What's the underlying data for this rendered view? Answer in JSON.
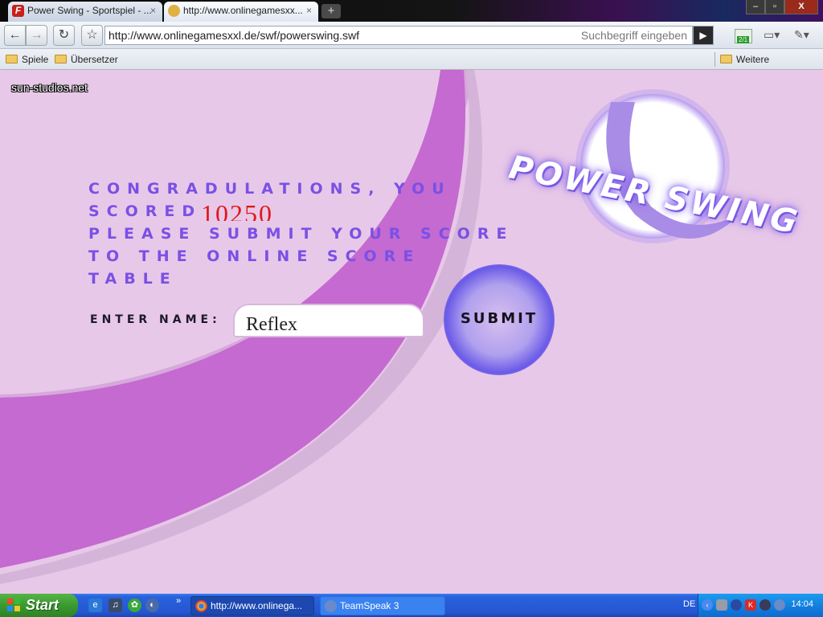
{
  "browser": {
    "tabs": [
      {
        "title": "Power Swing - Sportspiel - ...",
        "close": "×"
      },
      {
        "title": "http://www.onlinegamesxx...",
        "close": "×"
      }
    ],
    "new_tab": "+",
    "window_controls": {
      "minimize": "–",
      "maximize": "▫",
      "close": "X"
    },
    "nav": {
      "back": "←",
      "forward": "→",
      "reload": "↻",
      "star": "☆"
    },
    "url": "http://www.onlinegamesxxl.de/swf/powerswing.swf",
    "search_hint": "Suchbegriff eingeben",
    "go": "▶",
    "extension_badge": "2/1",
    "page_menu_icon": "page-icon",
    "wrench_menu_icon": "wrench-icon",
    "bookmarks": [
      {
        "label": "Spiele",
        "icon": "folder-icon"
      },
      {
        "label": "Übersetzer",
        "icon": "folder-icon"
      }
    ],
    "other_bookmarks": "Weitere Lesezeichen"
  },
  "game": {
    "credit": "sun-studios.net",
    "logo": "Power Swing",
    "message_lines": [
      "Congradulations, you",
      "scored",
      "please submit your score",
      "to the online score",
      "table"
    ],
    "score": "10250",
    "name_label": "Enter Name:",
    "name_value": "Reflex",
    "submit_label": "Submit",
    "colors": {
      "background": "#e8c8e8",
      "arc": "#c46ad0",
      "text": "#7a50e6",
      "score": "#e01818"
    }
  },
  "taskbar": {
    "start_label": "Start",
    "more": "»",
    "tasks": [
      {
        "label": "http://www.onlinega...",
        "icon": "chrome-icon"
      },
      {
        "label": "TeamSpeak 3",
        "icon": "teamspeak-icon"
      }
    ],
    "language": "DE",
    "clock": "14:04"
  }
}
